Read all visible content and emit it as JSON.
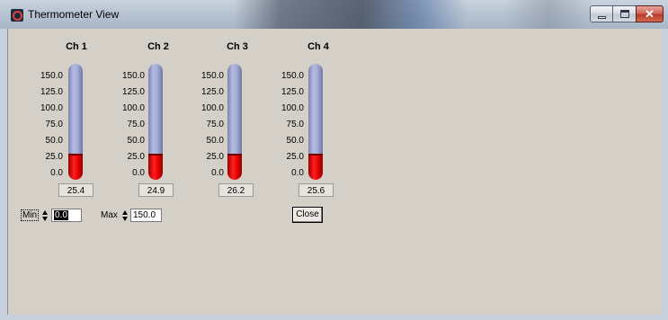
{
  "window": {
    "title": "Thermometer View",
    "controls": {
      "close_glyph": "✕"
    }
  },
  "channels": [
    {
      "name": "Ch 1",
      "value": "25.4",
      "reading": 25.4
    },
    {
      "name": "Ch 2",
      "value": "24.9",
      "reading": 24.9
    },
    {
      "name": "Ch 3",
      "value": "26.2",
      "reading": 26.2
    },
    {
      "name": "Ch 4",
      "value": "25.6",
      "reading": 25.6
    }
  ],
  "scale": {
    "ticks": [
      "150.0",
      "125.0",
      "100.0",
      "75.0",
      "50.0",
      "25.0",
      "0.0"
    ]
  },
  "controls": {
    "min_label": "Min",
    "min_value": "0.0",
    "max_label": "Max",
    "max_value": "150.0",
    "close_label": "Close"
  },
  "colors": {
    "mercury": "#e00000",
    "tube": "#a8afd8",
    "background": "#d4d0c8"
  }
}
